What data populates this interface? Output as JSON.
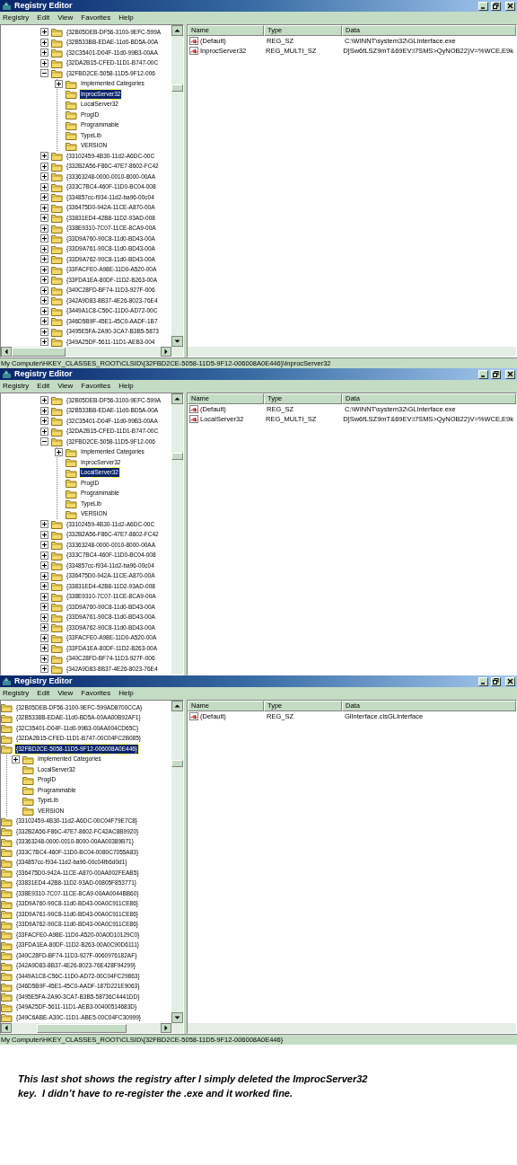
{
  "windows": [
    {
      "title": "Registry Editor",
      "menu": [
        "Registry",
        "Edit",
        "View",
        "Favorites",
        "Help"
      ],
      "tree_scrolled_right": false,
      "h_scrollbar": true,
      "tree": [
        {
          "label": "{32B05DEB-DF56-3100-9EFC-599A",
          "expanded": false,
          "selected": false
        },
        {
          "label": "{32B533BB-EDAE-11d0-BD5A-00A",
          "expanded": false,
          "selected": false
        },
        {
          "label": "{32C35401-D04F-11d0-99B3-00AA",
          "expanded": false,
          "selected": false
        },
        {
          "label": "{32DA2B15-CFED-11D1-B747-00C",
          "expanded": false,
          "selected": false
        },
        {
          "label": "{32FBD2CE-5058-11D5-9F12-006",
          "expanded": true,
          "selected": false,
          "children": [
            {
              "label": "Implemented Categories",
              "expanded": false,
              "selected": false
            },
            {
              "label": "InprocServer32",
              "selected": true
            },
            {
              "label": "LocalServer32",
              "selected": false
            },
            {
              "label": "ProgID",
              "selected": false
            },
            {
              "label": "Programmable",
              "selected": false
            },
            {
              "label": "TypeLib",
              "selected": false
            },
            {
              "label": "VERSION",
              "selected": false
            }
          ]
        },
        {
          "label": "{33102459-4B30-11d2-A6DC-00C",
          "expanded": false,
          "selected": false
        },
        {
          "label": "{332B2A56-F86C-47E7-8602-FC42",
          "expanded": false,
          "selected": false
        },
        {
          "label": "{33363248-0000-0010-8000-00AA",
          "expanded": false,
          "selected": false
        },
        {
          "label": "{333C7BC4-460F-11D0-BC04-008",
          "expanded": false,
          "selected": false
        },
        {
          "label": "{334857cc-f934-11d2-ba96-00c04",
          "expanded": false,
          "selected": false
        },
        {
          "label": "{336475D0-942A-11CE-A870-00A",
          "expanded": false,
          "selected": false
        },
        {
          "label": "{33831ED4-42B8-11D2-93AD-008",
          "expanded": false,
          "selected": false
        },
        {
          "label": "{338E9310-7C07-11CE-8CA9-00A",
          "expanded": false,
          "selected": false
        },
        {
          "label": "{33D9A760-90C8-11d0-BD43-00A",
          "expanded": false,
          "selected": false
        },
        {
          "label": "{33D9A761-90C8-11d0-BD43-00A",
          "expanded": false,
          "selected": false
        },
        {
          "label": "{33D9A762-90C8-11d0-BD43-00A",
          "expanded": false,
          "selected": false
        },
        {
          "label": "{33FACFE0-A98E-11D0-A520-00A",
          "expanded": false,
          "selected": false
        },
        {
          "label": "{33FDA1EA-80DF-11D2-B263-00A",
          "expanded": false,
          "selected": false
        },
        {
          "label": "{340C28FD-BF74-11D3-927F-006",
          "expanded": false,
          "selected": false
        },
        {
          "label": "{342A9D83-8B37-4E26-8023-76E4",
          "expanded": false,
          "selected": false
        },
        {
          "label": "{3449A1C8-C56C-11D0-AD72-00C",
          "expanded": false,
          "selected": false
        },
        {
          "label": "{346D5B9F-45E1-45C0-AADF-1B7",
          "expanded": false,
          "selected": false
        },
        {
          "label": "{3495E5FA-2A90-3CA7-B3B5-5873",
          "expanded": false,
          "selected": false
        },
        {
          "label": "{349A25DF-5611-11D1-AEB3-004",
          "expanded": false,
          "selected": false
        }
      ],
      "columns": [
        "Name",
        "Type",
        "Data"
      ],
      "values": [
        {
          "name": "(Default)",
          "type": "REG_SZ",
          "data": "C:\\WINNT\\system32\\GLInterface.exe"
        },
        {
          "name": "InprocServer32",
          "type": "REG_MULTI_SZ",
          "data": "D]Sw6fLSZ9mT&69EV:i7SMS>QyNOB22)V=%WCE,E9k"
        }
      ],
      "status": "My Computer\\HKEY_CLASSES_ROOT\\CLSID\\{32FBD2CE-5058-11D5-9F12-006008A0E446}\\InprocServer32"
    },
    {
      "title": "Registry Editor",
      "menu": [
        "Registry",
        "Edit",
        "View",
        "Favorites",
        "Help"
      ],
      "tree_scrolled_right": false,
      "h_scrollbar": false,
      "tree": [
        {
          "label": "{32B05DEB-DF56-3100-9EFC-599A",
          "expanded": false,
          "selected": false
        },
        {
          "label": "{32B533BB-EDAE-11d0-BD5A-00A",
          "expanded": false,
          "selected": false
        },
        {
          "label": "{32C35401-D04F-11d0-99B3-00AA",
          "expanded": false,
          "selected": false
        },
        {
          "label": "{32DA2B15-CFED-11D1-B747-00C",
          "expanded": false,
          "selected": false
        },
        {
          "label": "{32FBD2CE-5058-11D5-9F12-006",
          "expanded": true,
          "selected": false,
          "children": [
            {
              "label": "Implemented Categories",
              "expanded": false,
              "selected": false
            },
            {
              "label": "InprocServer32",
              "selected": false
            },
            {
              "label": "LocalServer32",
              "selected": true
            },
            {
              "label": "ProgID",
              "selected": false
            },
            {
              "label": "Programmable",
              "selected": false
            },
            {
              "label": "TypeLib",
              "selected": false
            },
            {
              "label": "VERSION",
              "selected": false
            }
          ]
        },
        {
          "label": "{33102459-4B30-11d2-A6DC-00C",
          "expanded": false,
          "selected": false
        },
        {
          "label": "{332B2A56-F86C-47E7-8602-FC42",
          "expanded": false,
          "selected": false
        },
        {
          "label": "{33363248-0000-0010-8000-00AA",
          "expanded": false,
          "selected": false
        },
        {
          "label": "{333C7BC4-460F-11D0-BC04-008",
          "expanded": false,
          "selected": false
        },
        {
          "label": "{334857cc-f934-11d2-ba96-00c04",
          "expanded": false,
          "selected": false
        },
        {
          "label": "{336475D0-942A-11CE-A870-00A",
          "expanded": false,
          "selected": false
        },
        {
          "label": "{33831ED4-42B8-11D2-93AD-008",
          "expanded": false,
          "selected": false
        },
        {
          "label": "{338E9310-7C07-11CE-8CA9-00A",
          "expanded": false,
          "selected": false
        },
        {
          "label": "{33D9A760-90C8-11d0-BD43-00A",
          "expanded": false,
          "selected": false
        },
        {
          "label": "{33D9A761-90C8-11d0-BD43-00A",
          "expanded": false,
          "selected": false
        },
        {
          "label": "{33D9A762-90C8-11d0-BD43-00A",
          "expanded": false,
          "selected": false
        },
        {
          "label": "{33FACFE0-A98E-11D0-A520-00A",
          "expanded": false,
          "selected": false
        },
        {
          "label": "{33FDA1EA-80DF-11D2-B263-00A",
          "expanded": false,
          "selected": false
        },
        {
          "label": "{340C28FD-BF74-11D3-927F-006",
          "expanded": false,
          "selected": false
        },
        {
          "label": "{342A9D83-8B37-4E26-8023-76E4",
          "expanded": false,
          "selected": false
        }
      ],
      "columns": [
        "Name",
        "Type",
        "Data"
      ],
      "values": [
        {
          "name": "(Default)",
          "type": "REG_SZ",
          "data": "C:\\WINNT\\system32\\GLInterface.exe"
        },
        {
          "name": "LocalServer32",
          "type": "REG_MULTI_SZ",
          "data": "D]Sw6fLSZ9mT&69EV:i7SMS>QyNOB22)V=%WCE,E9k"
        }
      ]
    },
    {
      "title": "Registry Editor",
      "menu": [
        "Registry",
        "Edit",
        "View",
        "Favorites",
        "Help"
      ],
      "tree_scrolled_right": true,
      "h_scrollbar": true,
      "tree": [
        {
          "label": "{32B05DEB-DF56-3100-9EFC-599AD8700CCA}",
          "selected": false
        },
        {
          "label": "{32B5338B-EDAE-11d0-BD5A-00AA00B92AF1}",
          "selected": false
        },
        {
          "label": "{32C35401-D04F-11d0-99B3-00AA004CD65C}",
          "selected": false
        },
        {
          "label": "{32DA2B15-CFED-11D1-B747-00C04FC2B085}",
          "selected": false
        },
        {
          "label": "{32FBD2CE-5058-11D5-9F12-006008A0E446}",
          "expanded": true,
          "selected": true,
          "children": [
            {
              "label": "Implemented Categories",
              "expanded": false,
              "selected": false
            },
            {
              "label": "LocalServer32",
              "selected": false
            },
            {
              "label": "ProgID",
              "selected": false
            },
            {
              "label": "Programmable",
              "selected": false
            },
            {
              "label": "TypeLib",
              "selected": false
            },
            {
              "label": "VERSION",
              "selected": false
            }
          ]
        },
        {
          "label": "{33102459-4B30-11d2-A6DC-00C04F79E7C8}",
          "selected": false
        },
        {
          "label": "{332B2A56-F86C-47E7-8602-FC42AC8B9920}",
          "selected": false
        },
        {
          "label": "{33363248-0000-0010-8000-00AA00389B71}",
          "selected": false
        },
        {
          "label": "{333C7BC4-460F-11D0-BC04-0080C7055A83}",
          "selected": false
        },
        {
          "label": "{334857cc-f934-11d2-ba96-00c04fb6d0d1}",
          "selected": false
        },
        {
          "label": "{336475D0-942A-11CE-A870-00AA002FEAB5}",
          "selected": false
        },
        {
          "label": "{33831ED4-42B8-11D2-93AD-00805F853771}",
          "selected": false
        },
        {
          "label": "{338E9310-7C07-11CE-8CA9-00AA0044BB60}",
          "selected": false
        },
        {
          "label": "{33D9A760-90C8-11d0-BD43-00A0C911CE86}",
          "selected": false
        },
        {
          "label": "{33D9A761-90C8-11d0-BD43-00A0C911CE86}",
          "selected": false
        },
        {
          "label": "{33D9A762-90C8-11d0-BD43-00A0C911CE86}",
          "selected": false
        },
        {
          "label": "{33FACFE0-A98E-11D0-A520-00A0D10129C0}",
          "selected": false
        },
        {
          "label": "{33FDA1EA-80DF-11D2-B263-00A0C90D6111}",
          "selected": false
        },
        {
          "label": "{340C28FD-BF74-11D3-927F-0060976182AF}",
          "selected": false
        },
        {
          "label": "{342A9D83-8B37-4E26-8023-76E428F94299}",
          "selected": false
        },
        {
          "label": "{3449A1C8-C56C-11D0-AD72-00C04FC29863}",
          "selected": false
        },
        {
          "label": "{346D5B9F-45E1-45C0-AADF-187D221E9063}",
          "selected": false
        },
        {
          "label": "{3495E5FA-2A90-3CA7-B3B5-58736C4441DD}",
          "selected": false
        },
        {
          "label": "{349A25DF-5611-11D1-AEB3-00400514683D}",
          "selected": false
        },
        {
          "label": "{349C6ABE-A30C-11D1-ABE5-00C04FC30999}",
          "selected": false
        }
      ],
      "columns": [
        "Name",
        "Type",
        "Data"
      ],
      "values": [
        {
          "name": "(Default)",
          "type": "REG_SZ",
          "data": "GlInterface.clsGLInterface"
        }
      ],
      "status": "My Computer\\HKEY_CLASSES_ROOT\\CLSID\\{32FBD2CE-5058-11D5-9F12-006008A0E446}"
    }
  ],
  "caption": [
    "This last shot shows the registry after I simply deleted the ImprocServer32",
    "key.  I didn’t have to re-register the .exe and it worked fine."
  ]
}
